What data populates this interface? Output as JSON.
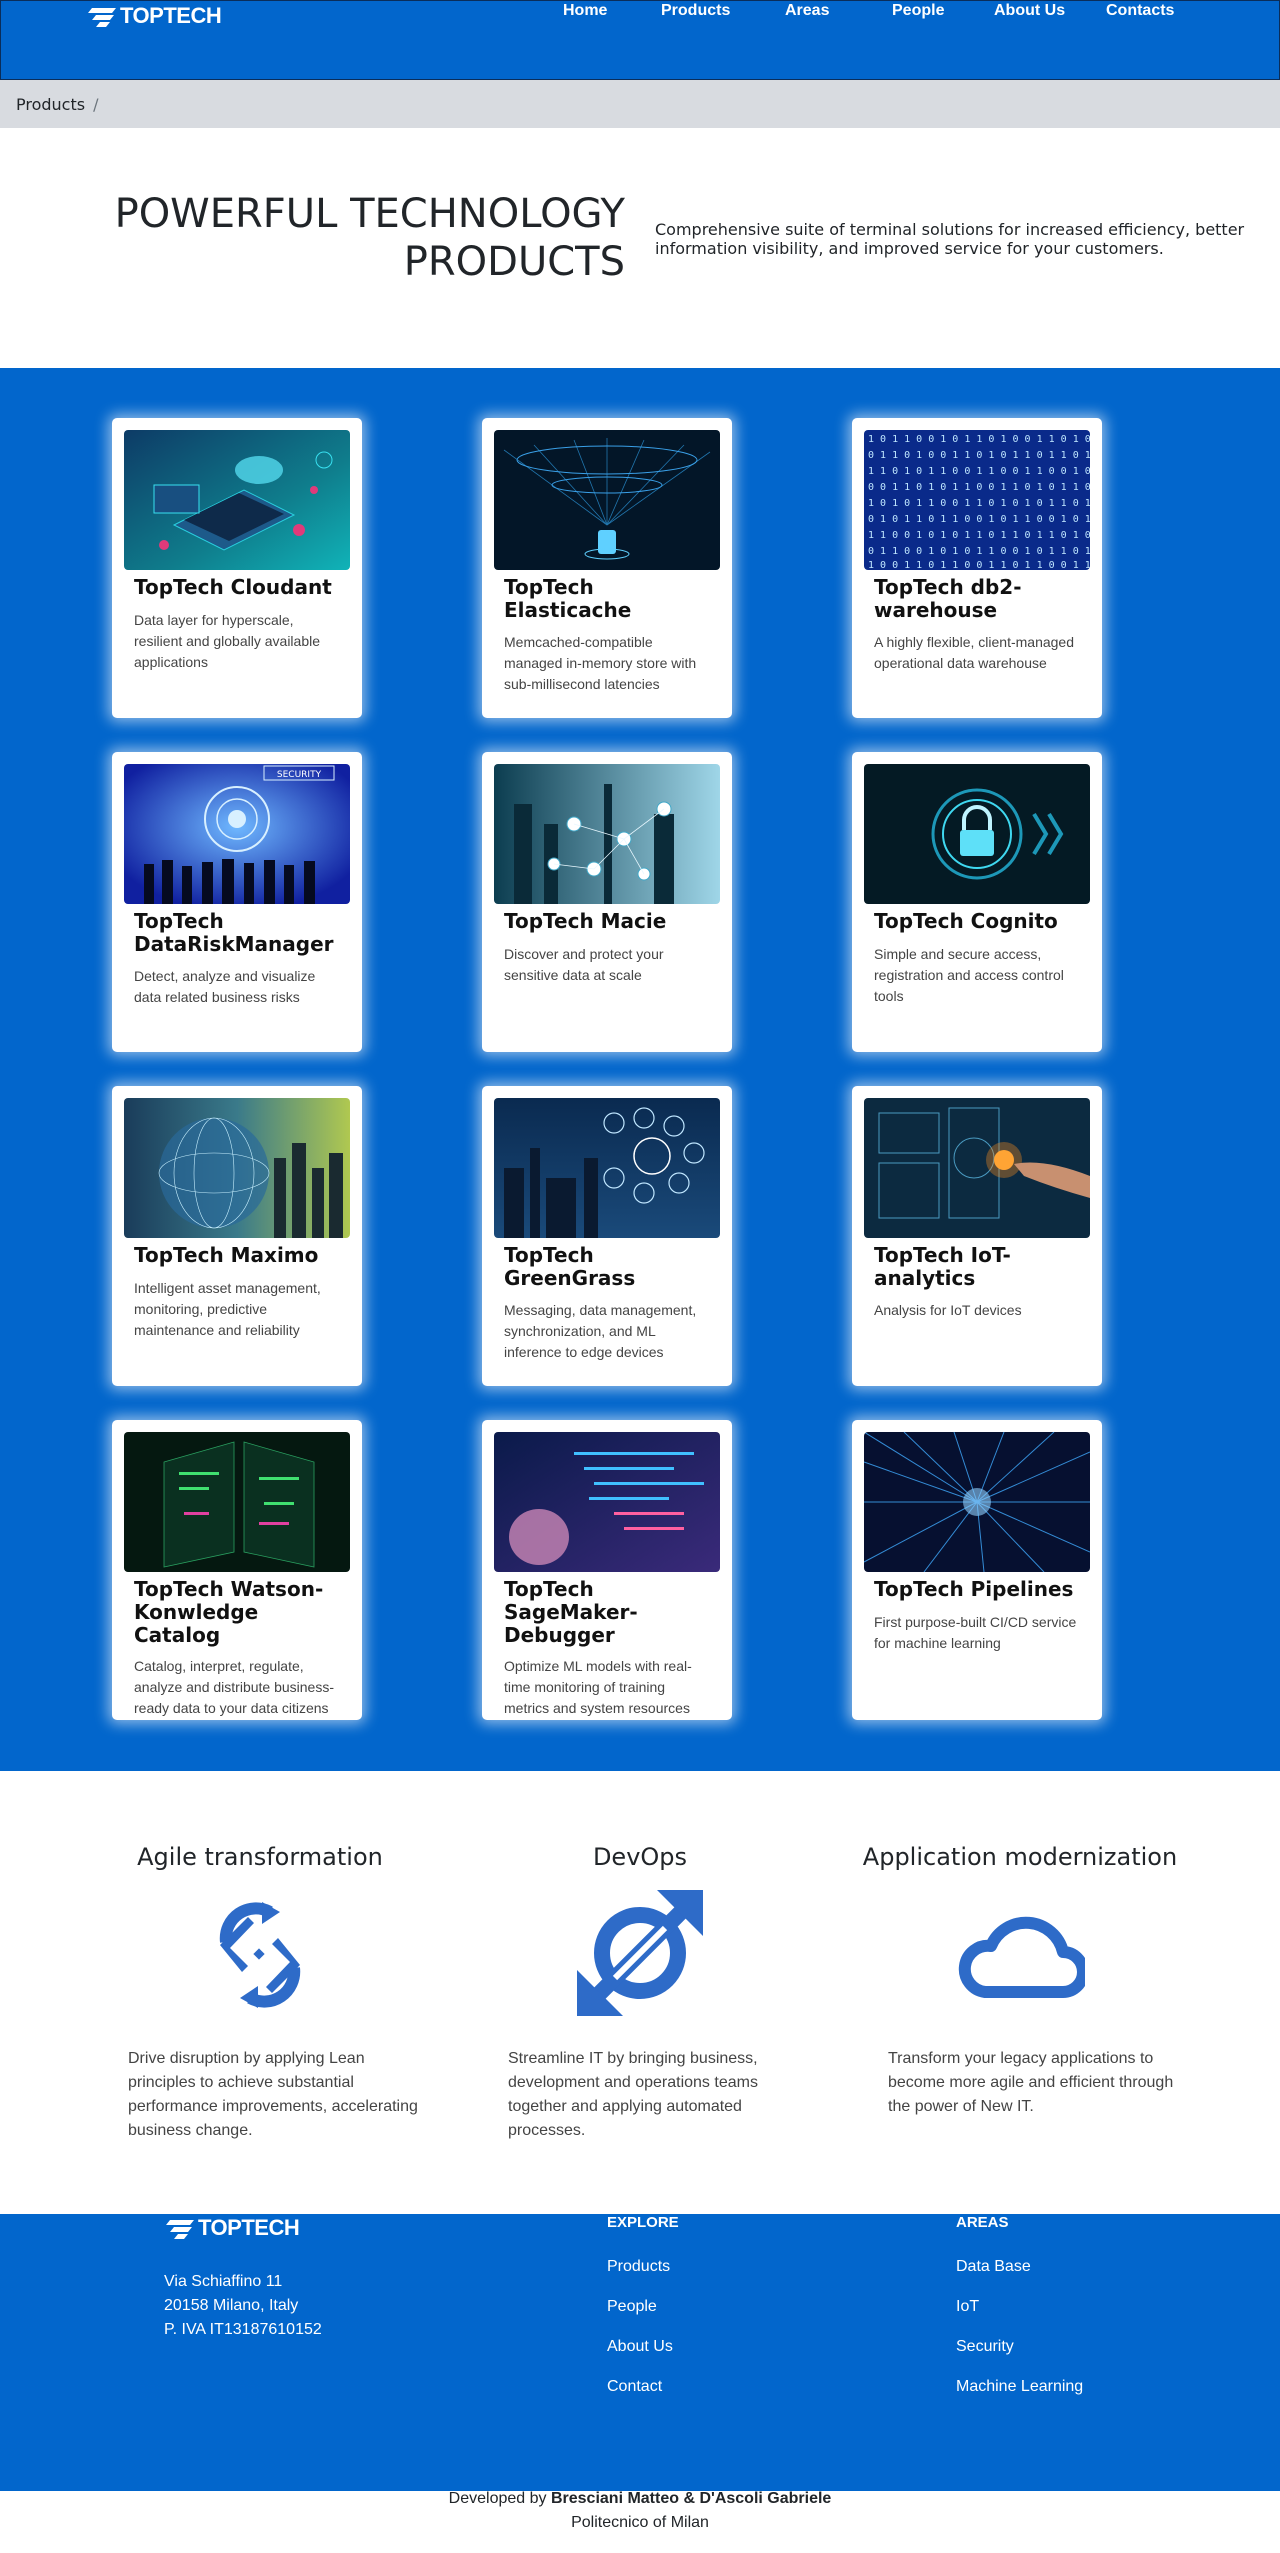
{
  "brand": {
    "name": "TOPTECH",
    "accent_color": "#0266cc"
  },
  "nav": {
    "items": [
      "Home",
      "Products",
      "Areas",
      "People",
      "About Us",
      "Contacts"
    ]
  },
  "breadcrumb": {
    "current": "Products",
    "separator": "/"
  },
  "hero": {
    "title_line1": "POWERFUL TECHNOLOGY",
    "title_line2": "PRODUCTS",
    "description": "Comprehensive suite of terminal solutions for increased efficiency, better information visibility, and improved service for your customers."
  },
  "products": [
    {
      "title": "TopTech Cloudant",
      "text": "Data layer for hyperscale, resilient and globally available applications",
      "image": "cloud-laptop-illustration"
    },
    {
      "title": "TopTech Elasticache",
      "text": "Memcached-compatible managed in-memory store with sub-millisecond latencies",
      "image": "network-funnel-illustration"
    },
    {
      "title": "TopTech db2-warehouse",
      "text": "A highly flexible, client-managed operational data warehouse",
      "image": "binary-matrix-illustration"
    },
    {
      "title": "TopTech DataRiskManager",
      "text": "Detect, analyze and visualize data related business risks",
      "image": "security-fingerprint-illustration",
      "badge": "SECURITY"
    },
    {
      "title": "TopTech Macie",
      "text": "Discover and protect your sensitive data at scale",
      "image": "industrial-network-illustration"
    },
    {
      "title": "TopTech Cognito",
      "text": "Simple and secure access, registration and access control tools",
      "image": "padlock-illustration"
    },
    {
      "title": "TopTech Maximo",
      "text": "Intelligent asset management, monitoring, predictive maintenance and reliability",
      "image": "globe-city-illustration"
    },
    {
      "title": "TopTech GreenGrass",
      "text": "Messaging, data management, synchronization, and ML inference to edge devices",
      "image": "smart-factory-illustration"
    },
    {
      "title": "TopTech IoT-analytics",
      "text": "Analysis for IoT devices",
      "image": "touch-screen-illustration"
    },
    {
      "title": "TopTech Watson-Konwledge Catalog",
      "text": "Catalog, interpret, regulate, analyze and distribute business-ready data to your data citizens",
      "image": "server-racks-illustration"
    },
    {
      "title": "TopTech SageMaker-Debugger",
      "text": "Optimize ML models with real-time monitoring of training metrics and system resources",
      "image": "ai-face-code-illustration"
    },
    {
      "title": "TopTech Pipelines",
      "text": "First purpose-built CI/CD service for machine learning",
      "image": "data-burst-illustration"
    }
  ],
  "features": [
    {
      "title": "Agile transformation",
      "icon": "refresh-arrows-icon",
      "text": "Drive disruption by applying Lean principles to achieve substantial performance improvements, accelerating business change."
    },
    {
      "title": "DevOps",
      "icon": "expand-link-icon",
      "text": "Streamline IT by bringing business, development and operations teams together and applying automated processes."
    },
    {
      "title": "Application modernization",
      "icon": "cloud-icon",
      "text": "Transform your legacy applications to become more agile and efficient through the power of New IT."
    }
  ],
  "footer": {
    "address": [
      "Via Schiaffino 11",
      "20158 Milano, Italy",
      "P. IVA IT13187610152"
    ],
    "explore": {
      "heading": "EXPLORE",
      "links": [
        "Products",
        "People",
        "About Us",
        "Contact"
      ]
    },
    "areas": {
      "heading": "AREAS",
      "links": [
        "Data Base",
        "IoT",
        "Security",
        "Machine Learning"
      ]
    }
  },
  "credits": {
    "prefix": "Developed by",
    "authors": "Bresciani Matteo & D'Ascoli Gabriele",
    "institution": "Politecnico of Milan"
  }
}
